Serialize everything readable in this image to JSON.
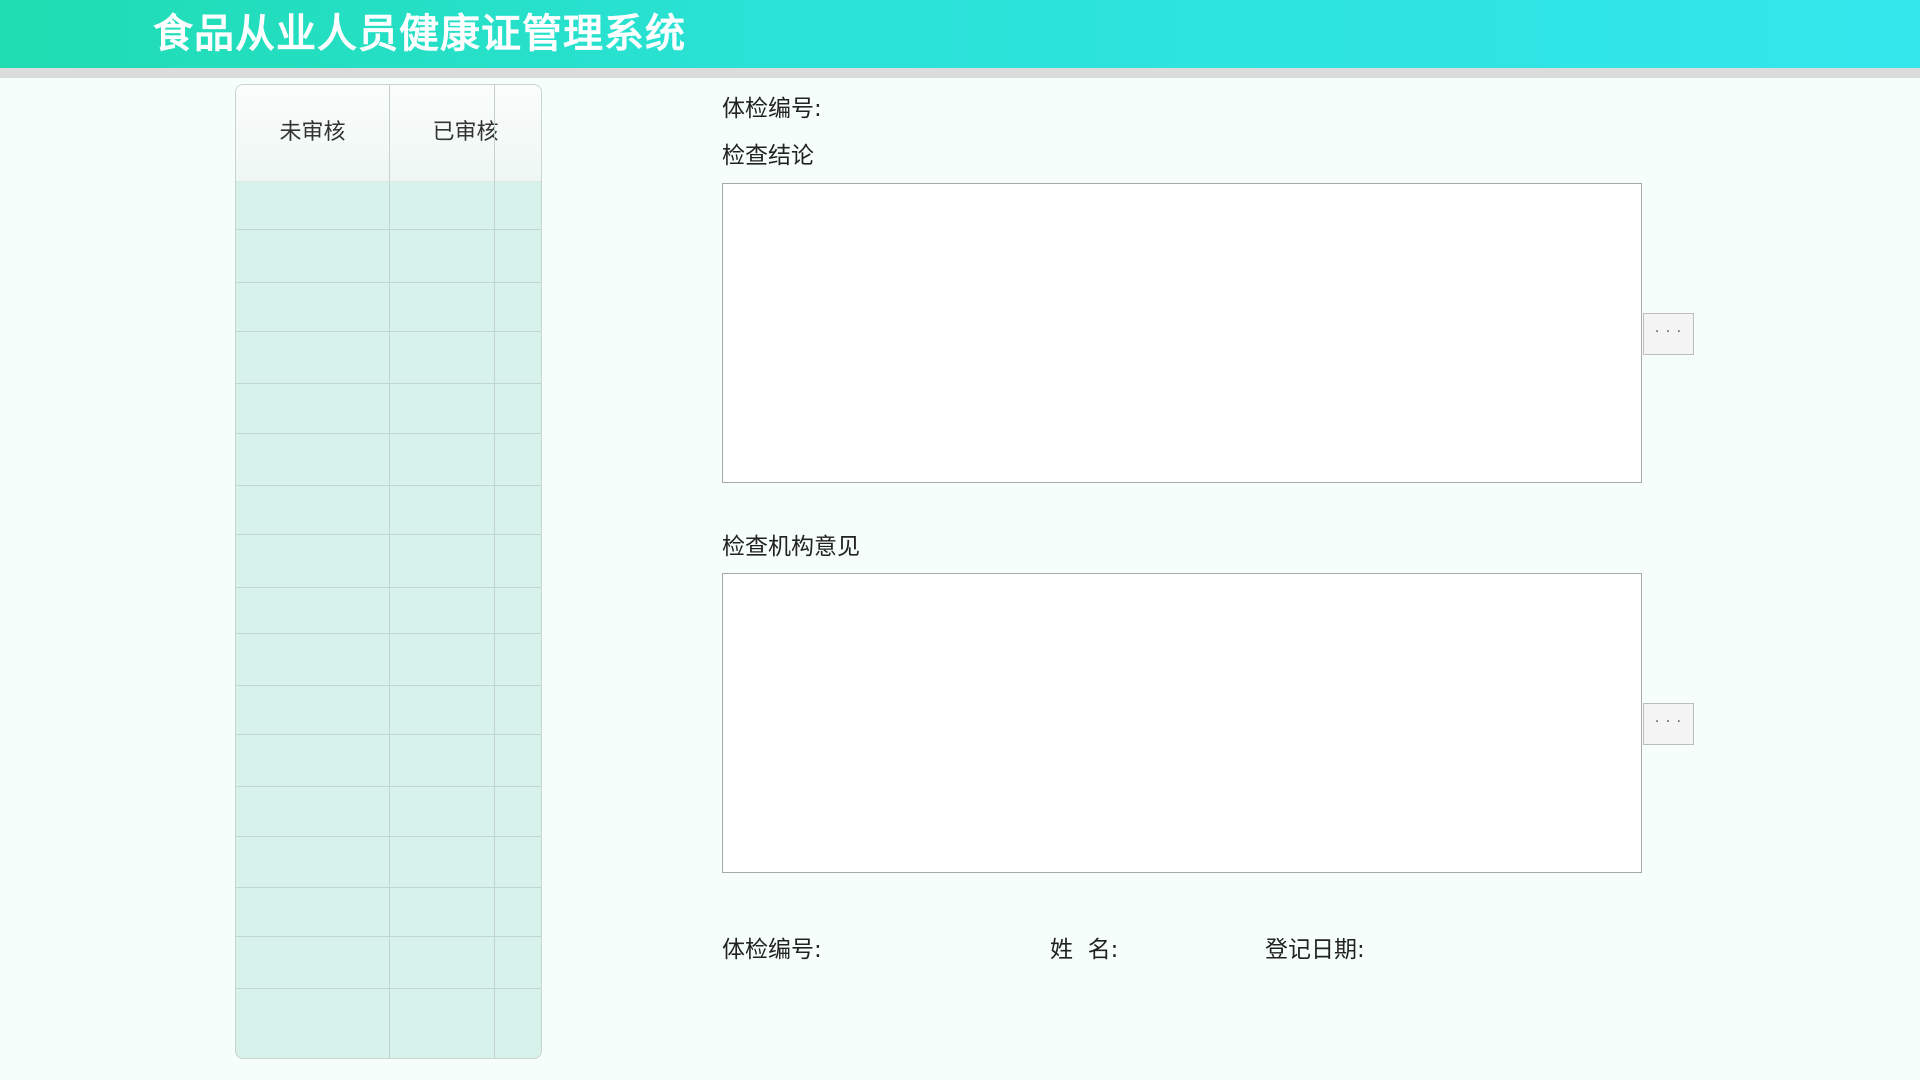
{
  "header": {
    "title": "食品从业人员健康证管理系统"
  },
  "grid": {
    "tabs": [
      "未审核",
      "已审核"
    ]
  },
  "form": {
    "exam_no_label": "体检编号:",
    "conclusion_label": "检查结论",
    "institution_opinion_label": "检查机构意见",
    "more_button_label": "· · ·"
  },
  "footer": {
    "exam_no_label": "体检编号:",
    "name_label": "姓  名:",
    "reg_date_label": "登记日期:"
  },
  "colors": {
    "title_gradient_start": "#1fdcb1",
    "title_gradient_end": "#33e6ec",
    "grid_row_bg": "#d7f2ea",
    "page_bg": "#f6fefb"
  }
}
